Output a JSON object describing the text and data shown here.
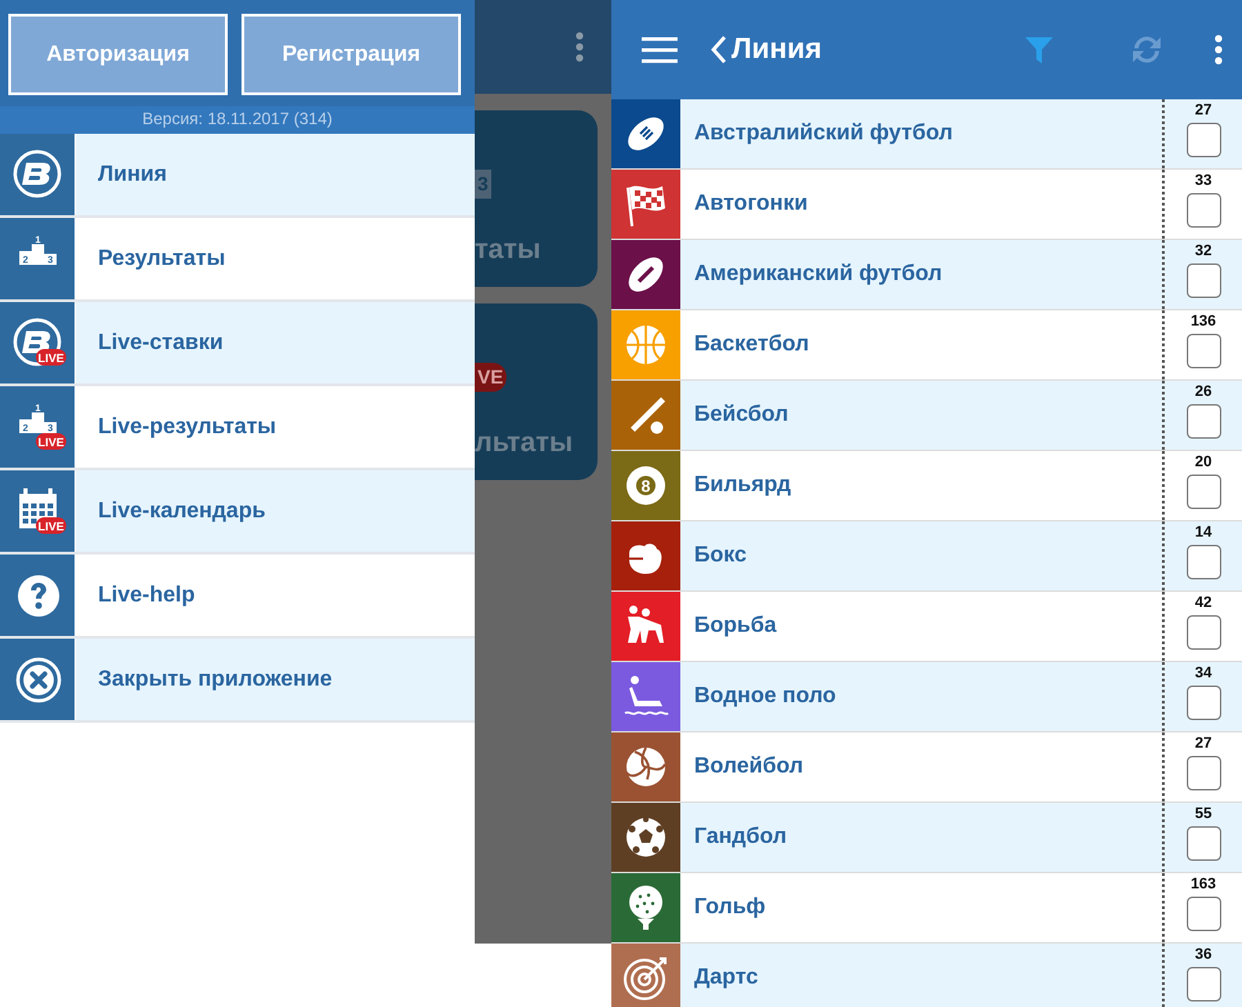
{
  "drawer": {
    "buttons": [
      "Авторизация",
      "Регистрация"
    ],
    "version": "Версия: 18.11.2017 (314)",
    "items": [
      {
        "label": "Линия"
      },
      {
        "label": "Результаты",
        "icon_text": [
          "1",
          "2",
          "3"
        ]
      },
      {
        "label": "Live-ставки",
        "badge": "LIVE"
      },
      {
        "label": "Live-результаты",
        "icon_text": [
          "1",
          "2",
          "3"
        ],
        "badge": "LIVE"
      },
      {
        "label": "Live-календарь",
        "badge": "LIVE"
      },
      {
        "label": "Live-help"
      },
      {
        "label": "Закрыть приложение"
      }
    ]
  },
  "background": {
    "cards": [
      {
        "fragment": "3",
        "label": "таты"
      },
      {
        "fragment": "VE",
        "label": "льтаты"
      }
    ]
  },
  "line_screen": {
    "title": "Линия",
    "sports": [
      {
        "name": "Австралийский футбол",
        "count": "27",
        "checked": false,
        "color": "#0b4a8e"
      },
      {
        "name": "Автогонки",
        "count": "33",
        "checked": false,
        "color": "#cf3333"
      },
      {
        "name": "Американский футбол",
        "count": "32",
        "checked": false,
        "color": "#6b1049"
      },
      {
        "name": "Баскетбол",
        "count": "136",
        "checked": false,
        "color": "#f7a000"
      },
      {
        "name": "Бейсбол",
        "count": "26",
        "checked": false,
        "color": "#aa6208"
      },
      {
        "name": "Бильярд",
        "count": "20",
        "checked": false,
        "color": "#7b6a16",
        "icon_text": [
          "8"
        ]
      },
      {
        "name": "Бокс",
        "count": "14",
        "checked": false,
        "color": "#a6200c"
      },
      {
        "name": "Борьба",
        "count": "42",
        "checked": false,
        "color": "#e31e26"
      },
      {
        "name": "Водное поло",
        "count": "34",
        "checked": false,
        "color": "#7b5ae0"
      },
      {
        "name": "Волейбол",
        "count": "27",
        "checked": false,
        "color": "#9a5232"
      },
      {
        "name": "Гандбол",
        "count": "55",
        "checked": false,
        "color": "#5f3f24"
      },
      {
        "name": "Гольф",
        "count": "163",
        "checked": false,
        "color": "#2a6a36"
      },
      {
        "name": "Дартс",
        "count": "36",
        "checked": false,
        "color": "#b06e50"
      }
    ]
  }
}
